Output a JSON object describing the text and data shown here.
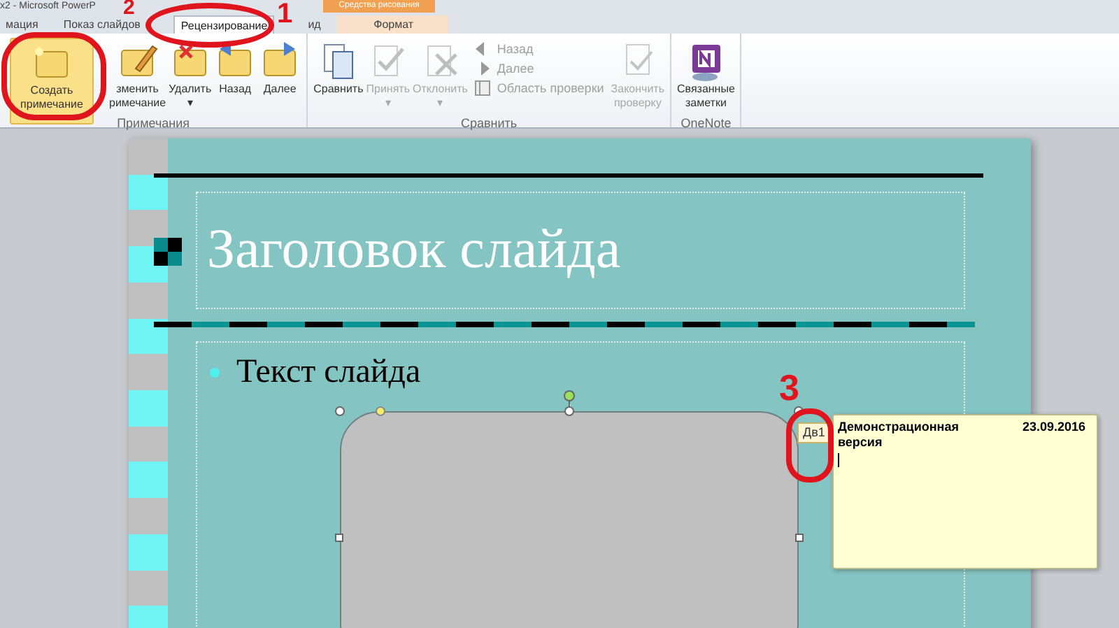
{
  "window": {
    "title": "х2 - Microsoft PowerP"
  },
  "contextual_tab_group": {
    "title": "Средства рисования"
  },
  "tabs": [
    {
      "label": "мация",
      "selected": false
    },
    {
      "label": "Показ слайдов",
      "selected": false
    },
    {
      "label": "Рецензирование",
      "selected": true
    },
    {
      "label": "ид",
      "selected": false
    },
    {
      "label": "Формат",
      "selected": false
    }
  ],
  "ribbon_groups": [
    {
      "label": "Примечания",
      "buttons": [
        {
          "kind": "large",
          "lines": [
            "Создать",
            "примечание"
          ],
          "disabled": false,
          "highlighted": true
        },
        {
          "kind": "large",
          "lines": [
            "зменить",
            "римечание"
          ],
          "disabled": false,
          "highlighted": false
        },
        {
          "kind": "large",
          "lines": [
            "Удалить",
            "▾"
          ],
          "disabled": false,
          "highlighted": false
        },
        {
          "kind": "large",
          "lines": [
            "Назад"
          ],
          "disabled": false,
          "highlighted": false
        },
        {
          "kind": "large",
          "lines": [
            "Далее"
          ],
          "disabled": false,
          "highlighted": false
        }
      ]
    },
    {
      "label": "Сравнить",
      "buttons": [
        {
          "kind": "large",
          "lines": [
            "Сравнить"
          ],
          "disabled": false,
          "highlighted": false
        },
        {
          "kind": "large",
          "lines": [
            "Принять",
            "▾"
          ],
          "disabled": true,
          "highlighted": false
        },
        {
          "kind": "large",
          "lines": [
            "Отклонить",
            "▾"
          ],
          "disabled": true,
          "highlighted": false
        },
        {
          "kind": "stack",
          "items": [
            {
              "label": "Назад"
            },
            {
              "label": "Далее"
            },
            {
              "label": "Область проверки"
            }
          ],
          "disabled": true
        },
        {
          "kind": "large",
          "lines": [
            "Закончить",
            "проверку"
          ],
          "disabled": true,
          "highlighted": false
        }
      ]
    },
    {
      "label": "OneNote",
      "buttons": [
        {
          "kind": "large",
          "lines": [
            "Связанные",
            "заметки"
          ],
          "disabled": false,
          "highlighted": false
        }
      ]
    }
  ],
  "slide": {
    "title": "Заголовок слайда",
    "bullets": [
      "Текст слайда"
    ]
  },
  "comment": {
    "marker": "Дв1",
    "author": "Демонстрационная версия",
    "date": "23.09.2016"
  },
  "annotations": [
    {
      "text": "1"
    },
    {
      "text": "2"
    },
    {
      "text": "3"
    }
  ]
}
